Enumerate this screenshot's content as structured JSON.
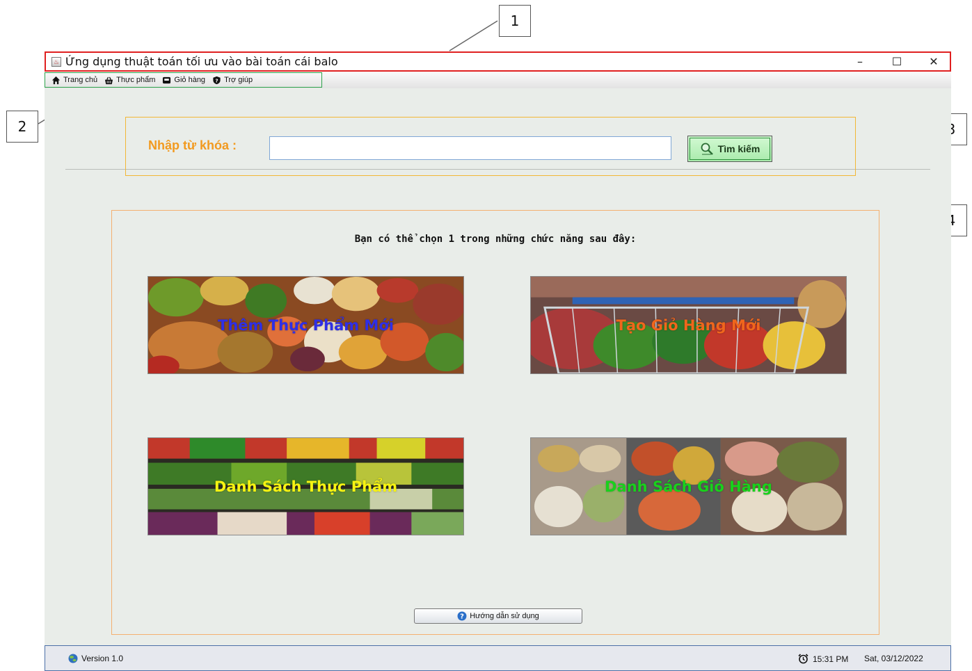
{
  "callouts": [
    "1",
    "2",
    "3",
    "4"
  ],
  "window": {
    "title": "Ứng dụng thuật toán tối ưu vào bài toán cái balo",
    "minimize": "–",
    "maximize": "☐",
    "close": "✕"
  },
  "menu": [
    {
      "label": "Trang chủ",
      "icon": "home-icon"
    },
    {
      "label": "Thực phẩm",
      "icon": "basket-icon"
    },
    {
      "label": "Giỏ hàng",
      "icon": "cart-box-icon"
    },
    {
      "label": "Trợ giúp",
      "icon": "help-shield-icon"
    }
  ],
  "search": {
    "label": "Nhập từ khóa :",
    "value": "",
    "button": "Tìm kiếm",
    "button_icon": "magnifier-icon"
  },
  "functions": {
    "prompt": "Bạn có thể chọn 1 trong những chức năng sau đây:",
    "cards": [
      {
        "label": "Thêm Thực Phẩm Mới",
        "color": "#2f2fe6"
      },
      {
        "label": "Tạo Giỏ Hàng Mới",
        "color": "#f0661c"
      },
      {
        "label": "Danh Sách Thực Phẩm",
        "color": "#f7f312"
      },
      {
        "label": "Danh Sách Giỏ Hàng",
        "color": "#19d11c"
      }
    ],
    "guide_button": "Hướng dẫn sử dụng"
  },
  "status": {
    "version": "Version 1.0",
    "time": "15:31 PM",
    "date": "Sat, 03/12/2022"
  },
  "colors": {
    "title_outline": "#e02020",
    "menu_outline": "#2ca24a",
    "search_outline": "#f2b735",
    "panel_outline": "#f4b070",
    "search_label": "#f29a1f"
  }
}
